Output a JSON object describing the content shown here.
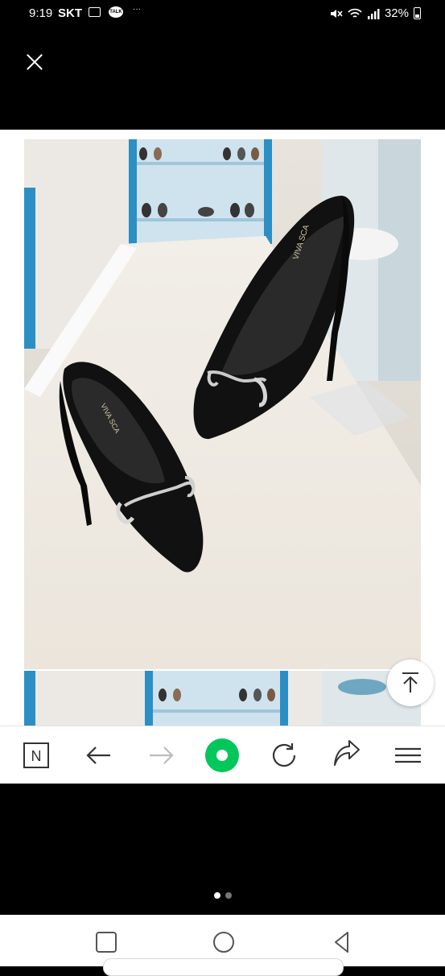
{
  "status_bar": {
    "time": "9:19",
    "carrier": "SKT",
    "talk_label": "TALK",
    "overflow": "···",
    "battery": "32%"
  },
  "viewer": {
    "photo_brand_text": "VIVA SCA",
    "page_indicator": {
      "count": 2,
      "active_index": 0
    }
  },
  "colors": {
    "accent": "#03c75a",
    "icon_gray": "#333333",
    "disabled_gray": "#bbbbbb",
    "dot_active": "#ffffff",
    "dot_inactive": "#777777"
  },
  "browser_toolbar": {
    "home_logo": "N",
    "icons": [
      "naver-home-icon",
      "back-arrow-icon",
      "forward-arrow-icon",
      "green-dot-icon",
      "refresh-icon",
      "share-icon",
      "menu-icon"
    ]
  },
  "system_nav": {
    "icons": [
      "recent-apps-icon",
      "home-icon",
      "back-icon"
    ]
  }
}
